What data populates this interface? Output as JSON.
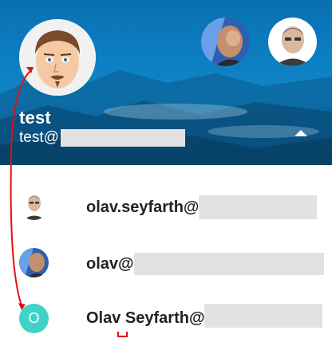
{
  "header": {
    "name": "test",
    "email_prefix": "test@"
  },
  "accounts": [
    {
      "email_prefix": "olav.seyfarth@",
      "avatar": "photo-avatar-man-light"
    },
    {
      "email_prefix": "olav@",
      "avatar": "photo-avatar-man-blue"
    },
    {
      "name_first": "Olav",
      "name_rest": " Seyfarth@",
      "avatar_letter": "O",
      "avatar_color": "#3fd3c8"
    }
  ],
  "colors": {
    "header_bg": "#0c7fc2",
    "annotation": "#e01010",
    "redaction": "#e2e2e2"
  }
}
